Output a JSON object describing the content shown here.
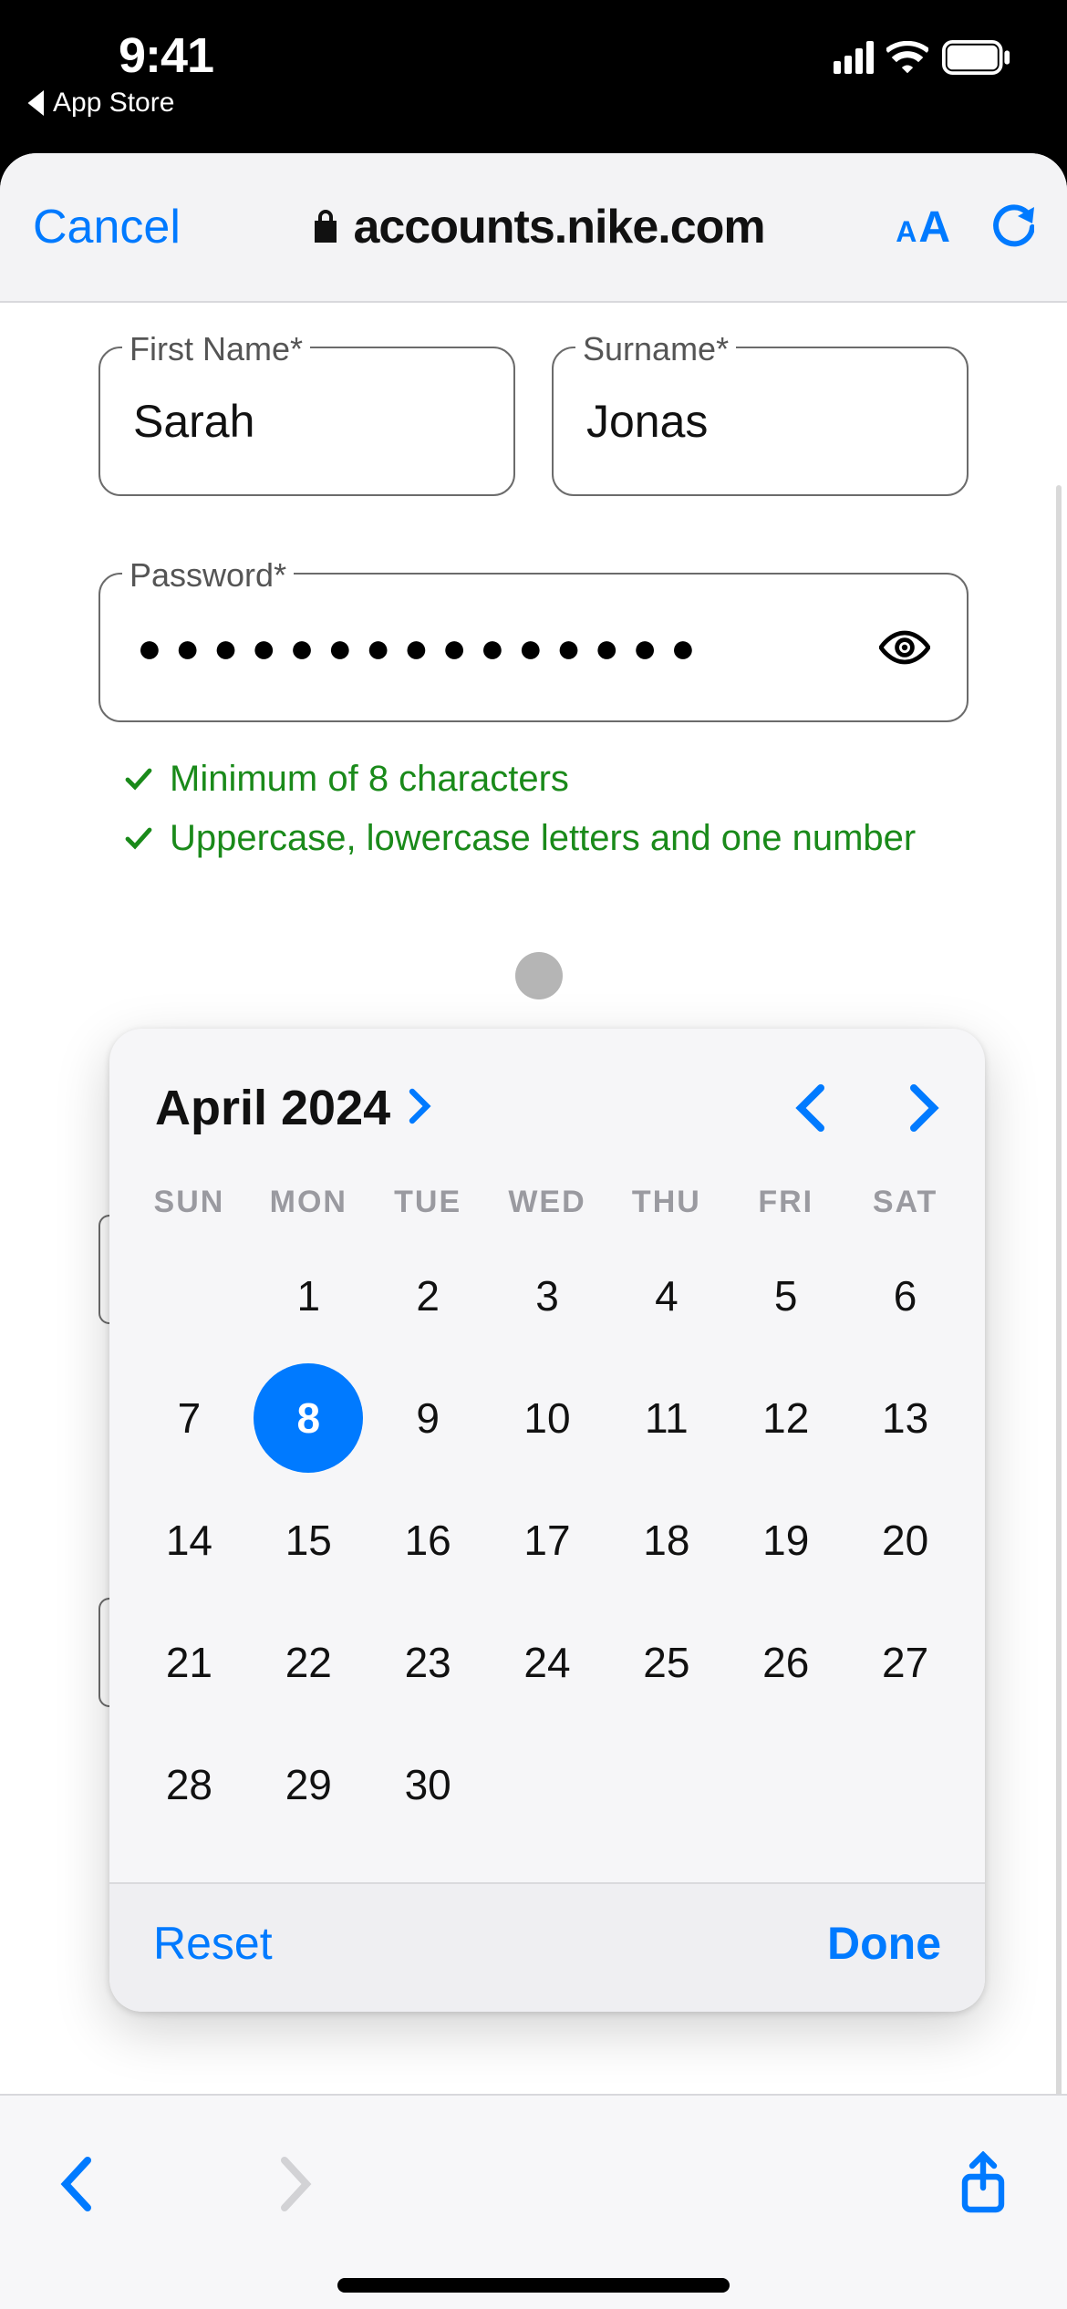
{
  "status": {
    "time": "9:41",
    "back_app": "App Store"
  },
  "safari": {
    "cancel": "Cancel",
    "domain": "accounts.nike.com"
  },
  "form": {
    "first_name_label": "First Name*",
    "first_name_value": "Sarah",
    "surname_label": "Surname*",
    "surname_value": "Jonas",
    "password_label": "Password*",
    "password_mask": "●●●●●●●●●●●●●●●",
    "rule1": "Minimum of 8 characters",
    "rule2": "Uppercase, lowercase letters and one number"
  },
  "calendar": {
    "month_label": "April 2024",
    "selected_day": 8,
    "dow": [
      "SUN",
      "MON",
      "TUE",
      "WED",
      "THU",
      "FRI",
      "SAT"
    ],
    "weeks": [
      [
        "",
        "1",
        "2",
        "3",
        "4",
        "5",
        "6"
      ],
      [
        "7",
        "8",
        "9",
        "10",
        "11",
        "12",
        "13"
      ],
      [
        "14",
        "15",
        "16",
        "17",
        "18",
        "19",
        "20"
      ],
      [
        "21",
        "22",
        "23",
        "24",
        "25",
        "26",
        "27"
      ],
      [
        "28",
        "29",
        "30",
        "",
        "",
        "",
        ""
      ]
    ],
    "reset": "Reset",
    "done": "Done"
  }
}
